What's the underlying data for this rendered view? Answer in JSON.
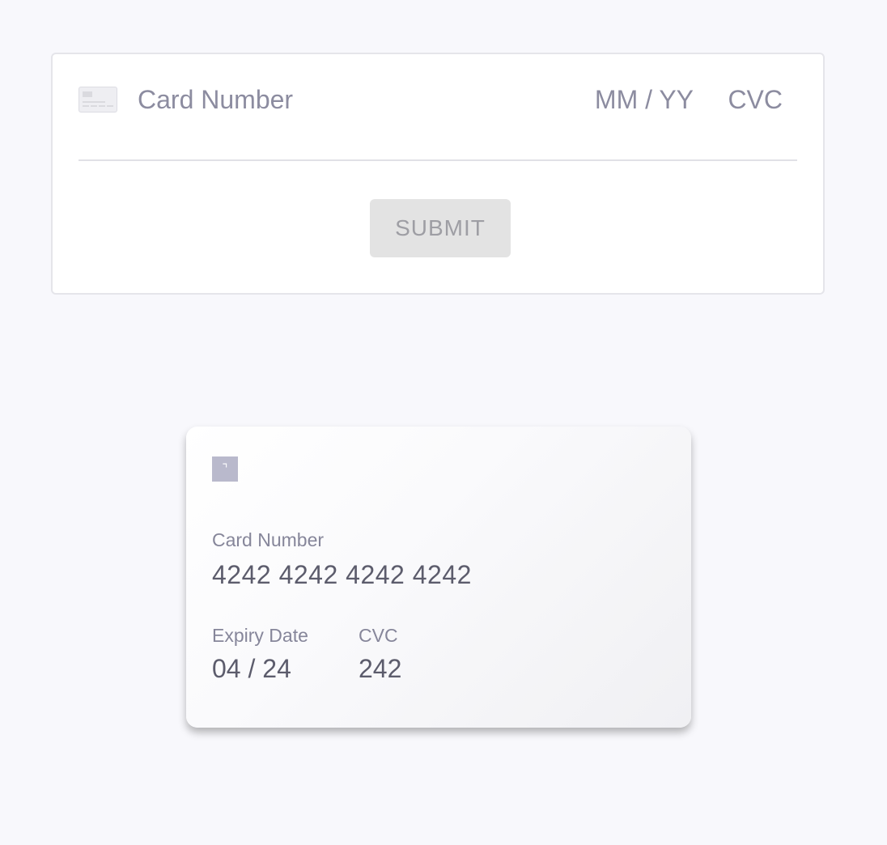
{
  "form": {
    "card_number_placeholder": "Card Number",
    "expiry_placeholder": "MM / YY",
    "cvc_placeholder": "CVC",
    "card_icon": "credit-card-icon",
    "submit_label": "SUBMIT"
  },
  "preview": {
    "brand_icon": "card-brand-icon",
    "brand_glyph": "⌝",
    "card_number_label": "Card Number",
    "card_number_value": "4242 4242 4242 4242",
    "expiry_label": "Expiry Date",
    "expiry_value": "04 / 24",
    "cvc_label": "CVC",
    "cvc_value": "242"
  },
  "colors": {
    "background": "#f8f8fc",
    "placeholder_text": "#8c8ca0",
    "submit_disabled_bg": "#e3e3e3",
    "submit_disabled_text": "#9e9ea4",
    "preview_value_text": "#5c5c6c",
    "brand_box": "#b9b9cc"
  }
}
